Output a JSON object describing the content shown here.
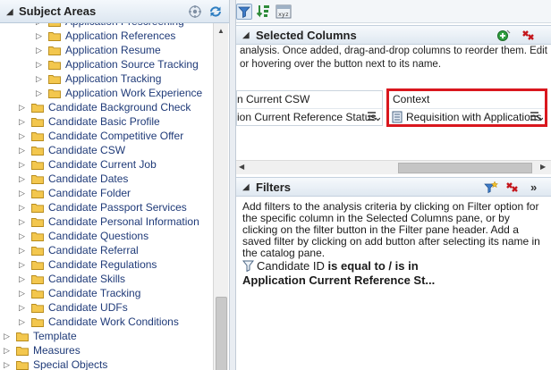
{
  "left_pane": {
    "title": "Subject Areas",
    "header_icons": [
      "refresh-settings-icon",
      "refresh-icon"
    ],
    "tree": [
      {
        "label": "Application Prescreening",
        "depth": 3
      },
      {
        "label": "Application References",
        "depth": 3
      },
      {
        "label": "Application Resume",
        "depth": 3
      },
      {
        "label": "Application Source Tracking",
        "depth": 3
      },
      {
        "label": "Application Tracking",
        "depth": 3
      },
      {
        "label": "Application Work Experience",
        "depth": 3
      },
      {
        "label": "Candidate Background Check",
        "depth": 2
      },
      {
        "label": "Candidate Basic Profile",
        "depth": 2
      },
      {
        "label": "Candidate Competitive Offer",
        "depth": 2
      },
      {
        "label": "Candidate CSW",
        "depth": 2
      },
      {
        "label": "Candidate Current Job",
        "depth": 2
      },
      {
        "label": "Candidate Dates",
        "depth": 2
      },
      {
        "label": "Candidate Folder",
        "depth": 2
      },
      {
        "label": "Candidate Passport Services",
        "depth": 2
      },
      {
        "label": "Candidate Personal Information",
        "depth": 2
      },
      {
        "label": "Candidate Questions",
        "depth": 2
      },
      {
        "label": "Candidate Referral",
        "depth": 2
      },
      {
        "label": "Candidate Regulations",
        "depth": 2
      },
      {
        "label": "Candidate Skills",
        "depth": 2
      },
      {
        "label": "Candidate Tracking",
        "depth": 2
      },
      {
        "label": "Candidate UDFs",
        "depth": 2
      },
      {
        "label": "Candidate Work Conditions",
        "depth": 2
      },
      {
        "label": "Template",
        "depth": 1
      },
      {
        "label": "Measures",
        "depth": 1
      },
      {
        "label": "Special Objects",
        "depth": 1
      }
    ]
  },
  "toolbar": {
    "buttons": [
      "filter-icon",
      "sort-icon",
      "xyz-icon"
    ]
  },
  "selected_columns": {
    "title": "Selected Columns",
    "hint": "analysis. Once added, drag-and-drop columns to reorder them. Edit a or hovering over the button next to its name.",
    "hint_line1": "analysis. Once added, drag-and-drop columns to reorder them. Edit a",
    "hint_line2": "or hovering over the button next to its name.",
    "header_icons": [
      "add-column-icon",
      "remove-all-icon"
    ],
    "columns": [
      {
        "folder": "n Current CSW",
        "name": "ion Current Reference Status"
      },
      {
        "folder": "Context",
        "name": "Requisition with Applications"
      }
    ]
  },
  "filters": {
    "title": "Filters",
    "header_icons": [
      "new-filter-icon",
      "delete-filters-icon",
      "more-icon"
    ],
    "help_text": "Add filters to the analysis criteria by clicking on Filter option for the specific column in the Selected Columns pane, or by clicking on the filter button in the Filter pane header. Add a saved filter by clicking on add button after selecting its name in the catalog pane.",
    "filter": {
      "column": "Candidate ID",
      "operator": "is equal to / is in",
      "value": "Application Current Reference St..."
    }
  },
  "colors": {
    "highlight": "#d9171e",
    "folder": "#f3c74e",
    "header_bg": "#dde7f1",
    "link_text": "#1f3a78"
  }
}
